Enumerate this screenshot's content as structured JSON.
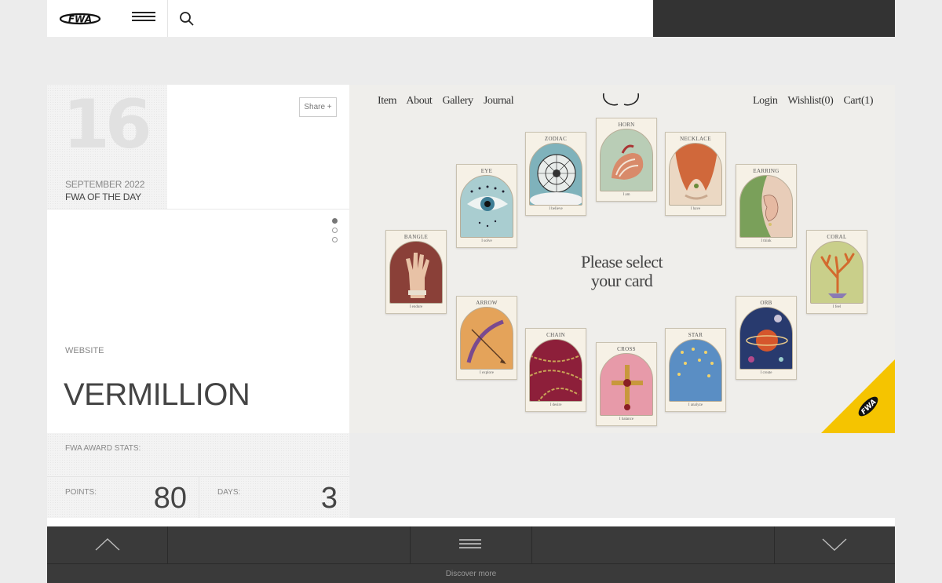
{
  "header": {
    "logo_text": "FWA",
    "colors": {
      "dark_block": "#333333"
    }
  },
  "award": {
    "day": "16",
    "month": "SEPTEMBER 2022",
    "label": "FWA OF THE DAY",
    "share_label": "Share +",
    "type": "WEBSITE",
    "title": "VERMILLION",
    "stats_label": "FWA AWARD STATS:",
    "points_label": "POINTS:",
    "points": "80",
    "days_label": "DAYS:",
    "days": "3"
  },
  "site": {
    "nav_left": [
      "Item",
      "About",
      "Gallery",
      "Journal"
    ],
    "nav_right": [
      "Login",
      "Wishlist(0)",
      "Cart(1)"
    ],
    "prompt_line1": "Please select",
    "prompt_line2": "your card",
    "cards": [
      {
        "name": "BANGLE",
        "caption": "I endure"
      },
      {
        "name": "EYE",
        "caption": "I solve"
      },
      {
        "name": "ZODIAC",
        "caption": "I believe"
      },
      {
        "name": "HORN",
        "caption": "I am"
      },
      {
        "name": "NECKLACE",
        "caption": "I have"
      },
      {
        "name": "EARRING",
        "caption": "I think"
      },
      {
        "name": "CORAL",
        "caption": "I feel"
      },
      {
        "name": "ARROW",
        "caption": "I explore"
      },
      {
        "name": "CHAIN",
        "caption": "I desire"
      },
      {
        "name": "CROSS",
        "caption": "I balance"
      },
      {
        "name": "STAR",
        "caption": "I analyze"
      },
      {
        "name": "ORB",
        "caption": "I create"
      }
    ],
    "ribbon_text": "FWA",
    "ribbon_color": "#f5c400"
  },
  "footer": {
    "discover_label": "Discover more"
  }
}
